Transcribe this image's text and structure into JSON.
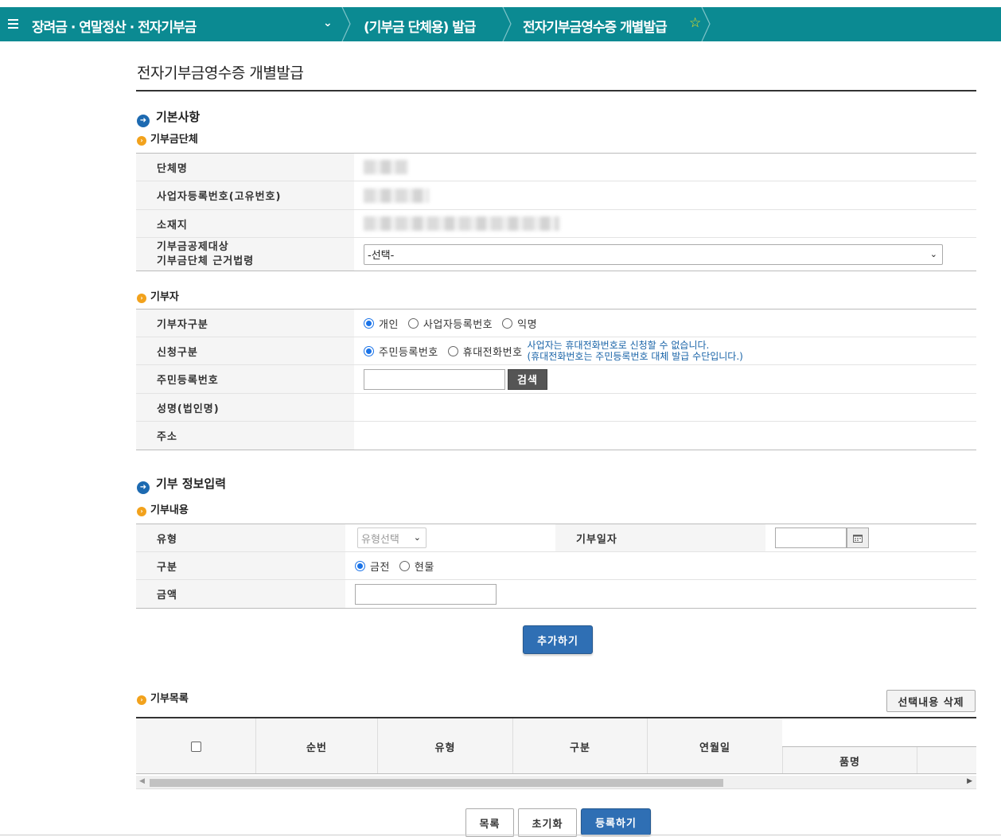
{
  "nav": {
    "crumb1": "장려금 · 연말정산 · 전자기부금",
    "crumb2": "(기부금 단체용) 발급",
    "crumb3": "전자기부금영수증 개별발급"
  },
  "page_title": "전자기부금영수증 개별발급",
  "basic": {
    "title": "기본사항",
    "org_section": "기부금단체",
    "org_name_label": "단체명",
    "biz_no_label": "사업자등록번호(고유번호)",
    "address_label": "소재지",
    "legal_basis_label_1": "기부금공제대상",
    "legal_basis_label_2": "기부금단체 근거법령",
    "legal_basis_value": "-선택-",
    "donor_section": "기부자",
    "donor_type_label": "기부자구분",
    "donor_type_options": [
      "개인",
      "사업자등록번호",
      "익명"
    ],
    "apply_type_label": "신청구분",
    "apply_type_options": [
      "주민등록번호",
      "휴대전화번호"
    ],
    "apply_note_1": "사업자는 휴대전화번호로 신청할 수 없습니다.",
    "apply_note_2": "(휴대전화번호는 주민등록번호 대체 발급 수단입니다.)",
    "rrn_label": "주민등록번호",
    "search_label": "검색",
    "name_label": "성명(법인명)",
    "addr_label": "주소"
  },
  "donation": {
    "title": "기부 정보입력",
    "content_section": "기부내용",
    "type_label": "유형",
    "type_select": "유형선택",
    "date_label": "기부일자",
    "kind_label": "구분",
    "kind_options": [
      "금전",
      "현물"
    ],
    "amount_label": "금액",
    "add_button": "추가하기"
  },
  "list": {
    "section": "기부목록",
    "delete_button": "선택내용 삭제",
    "columns": [
      "순번",
      "유형",
      "구분",
      "연월일",
      "품명"
    ]
  },
  "footer": {
    "list_button": "목록",
    "reset_button": "초기화",
    "register_button": "등록하기"
  },
  "colors": {
    "nav_bg": "#0b8a92",
    "accent_blue": "#2f6fb4",
    "note_blue": "#1a64a8"
  }
}
